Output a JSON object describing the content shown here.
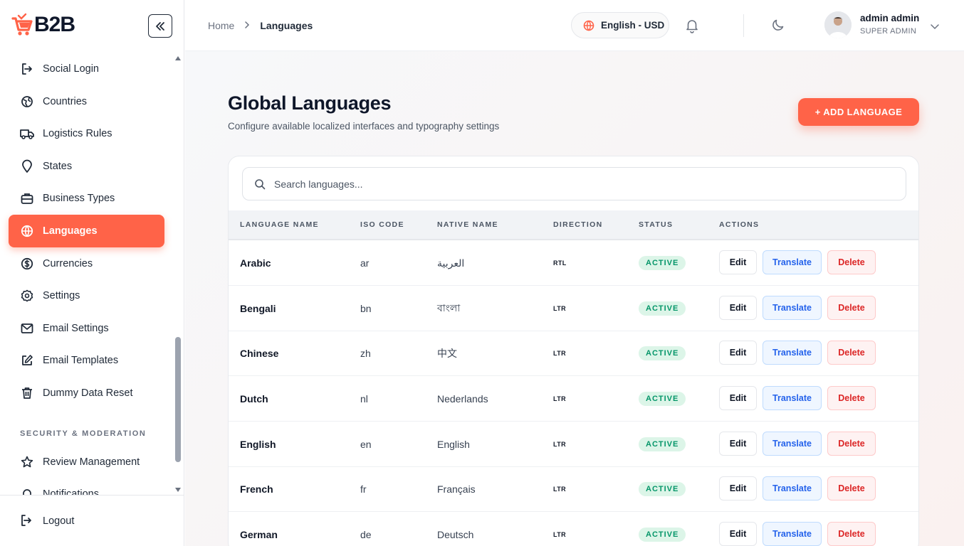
{
  "brand": {
    "name": "B2B",
    "accent": "#ff6348"
  },
  "sidebar": {
    "items": [
      {
        "label": "Social Login",
        "icon": "login-icon"
      },
      {
        "label": "Countries",
        "icon": "globe-icon"
      },
      {
        "label": "Logistics Rules",
        "icon": "truck-icon"
      },
      {
        "label": "States",
        "icon": "map-pin-icon"
      },
      {
        "label": "Business Types",
        "icon": "briefcase-icon"
      },
      {
        "label": "Languages",
        "icon": "globe-icon",
        "active": true
      },
      {
        "label": "Currencies",
        "icon": "dollar-icon"
      },
      {
        "label": "Settings",
        "icon": "gear-icon"
      },
      {
        "label": "Email Settings",
        "icon": "mail-icon"
      },
      {
        "label": "Email Templates",
        "icon": "edit-icon"
      },
      {
        "label": "Dummy Data Reset",
        "icon": "trash-icon"
      },
      {
        "label": "Review Management",
        "icon": "star-icon"
      },
      {
        "label": "Notifications",
        "icon": "bell-icon"
      }
    ],
    "section_security": "SECURITY & MODERATION",
    "logout_label": "Logout"
  },
  "header": {
    "breadcrumb_home": "Home",
    "breadcrumb_current": "Languages",
    "locale_label": "English - USD",
    "user_name": "admin admin",
    "user_role": "SUPER ADMIN"
  },
  "page": {
    "title": "Global Languages",
    "subtitle": "Configure available localized interfaces and typography settings",
    "add_button": "+ ADD LANGUAGE",
    "search_placeholder": "Search languages..."
  },
  "table": {
    "columns": [
      "LANGUAGE NAME",
      "ISO CODE",
      "NATIVE NAME",
      "DIRECTION",
      "STATUS",
      "ACTIONS"
    ],
    "actions": {
      "edit": "Edit",
      "translate": "Translate",
      "delete": "Delete"
    },
    "rows": [
      {
        "name": "Arabic",
        "iso": "ar",
        "native": "العربية",
        "direction": "RTL",
        "status": "ACTIVE"
      },
      {
        "name": "Bengali",
        "iso": "bn",
        "native": "বাংলা",
        "direction": "LTR",
        "status": "ACTIVE"
      },
      {
        "name": "Chinese",
        "iso": "zh",
        "native": "中文",
        "direction": "LTR",
        "status": "ACTIVE"
      },
      {
        "name": "Dutch",
        "iso": "nl",
        "native": "Nederlands",
        "direction": "LTR",
        "status": "ACTIVE"
      },
      {
        "name": "English",
        "iso": "en",
        "native": "English",
        "direction": "LTR",
        "status": "ACTIVE"
      },
      {
        "name": "French",
        "iso": "fr",
        "native": "Français",
        "direction": "LTR",
        "status": "ACTIVE"
      },
      {
        "name": "German",
        "iso": "de",
        "native": "Deutsch",
        "direction": "LTR",
        "status": "ACTIVE"
      }
    ]
  }
}
